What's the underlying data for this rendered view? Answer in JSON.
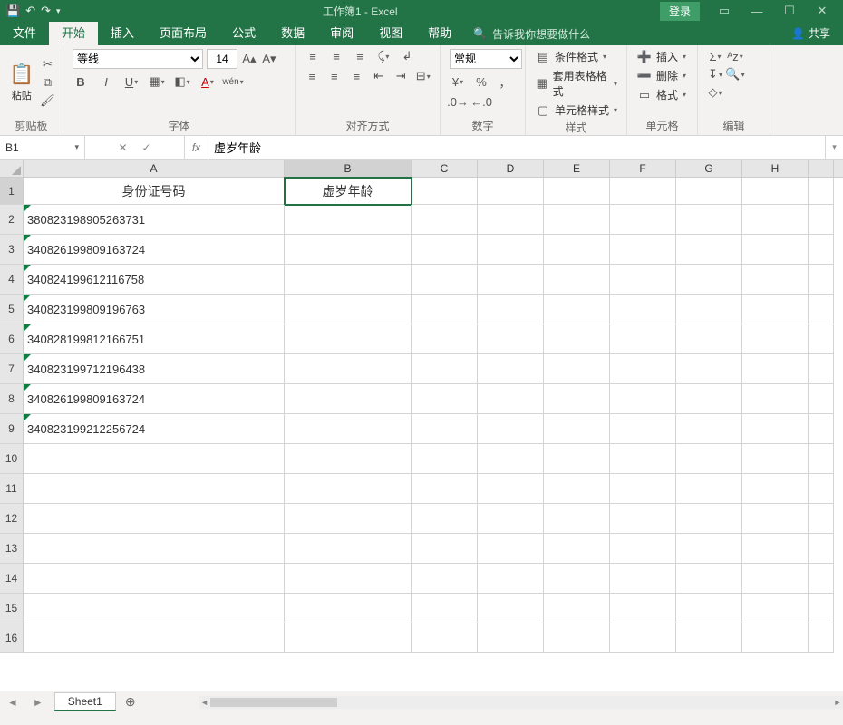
{
  "title": "工作簿1 - Excel",
  "login": "登录",
  "tabs": {
    "file": "文件",
    "home": "开始",
    "insert": "插入",
    "layout": "页面布局",
    "formula": "公式",
    "data": "数据",
    "review": "审阅",
    "view": "视图",
    "help": "帮助",
    "tell": "告诉我你想要做什么",
    "share": "共享"
  },
  "ribbon": {
    "clipboard": {
      "label": "剪贴板",
      "paste": "粘贴"
    },
    "font": {
      "label": "字体",
      "name": "等线",
      "size": "14"
    },
    "align": {
      "label": "对齐方式"
    },
    "number": {
      "label": "数字",
      "format": "常规"
    },
    "styles": {
      "label": "样式",
      "cond": "条件格式",
      "table": "套用表格格式",
      "cell": "单元格样式"
    },
    "cells": {
      "label": "单元格",
      "insert": "插入",
      "delete": "删除",
      "format": "格式"
    },
    "editing": {
      "label": "编辑"
    }
  },
  "namebox": "B1",
  "formula": "虚岁年龄",
  "cols": [
    "A",
    "B",
    "C",
    "D",
    "E",
    "F",
    "G",
    "H"
  ],
  "rows": [
    {
      "a": "身份证号码",
      "b": "虚岁年龄",
      "header": true
    },
    {
      "a": "380823198905263731"
    },
    {
      "a": "340826199809163724"
    },
    {
      "a": "340824199612116758"
    },
    {
      "a": "340823199809196763"
    },
    {
      "a": "340828199812166751"
    },
    {
      "a": "340823199712196438"
    },
    {
      "a": "340826199809163724"
    },
    {
      "a": "340823199212256724"
    },
    {},
    {},
    {},
    {},
    {},
    {},
    {}
  ],
  "sheet": "Sheet1"
}
